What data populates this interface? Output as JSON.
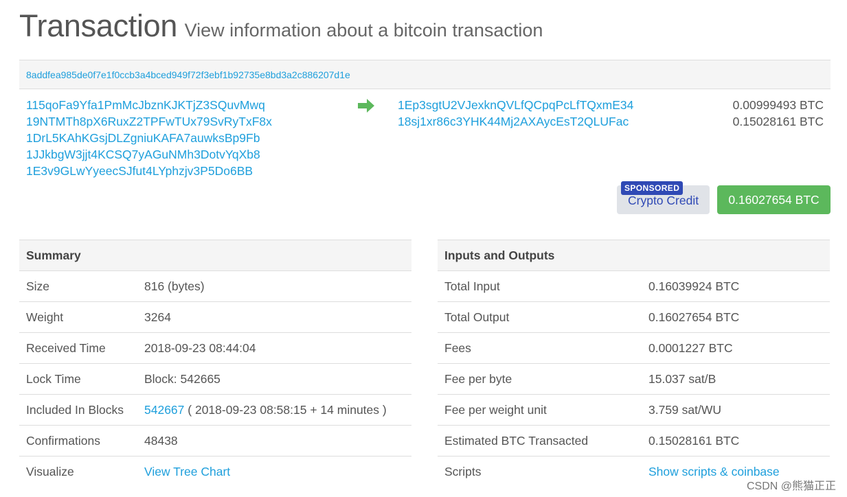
{
  "header": {
    "title": "Transaction",
    "subtitle": "View information about a bitcoin transaction"
  },
  "tx": {
    "hash": "8addfea985de0f7e1f0ccb3a4bced949f72f3ebf1b92735e8bd3a2c886207d1e",
    "inputs": [
      "115qoFa9Yfa1PmMcJbznKJKTjZ3SQuvMwq",
      "19NTMTh8pX6RuxZ2TPFwTUx79SvRyTxF8x",
      "1DrL5KAhKGsjDLZgniuKAFA7auwksBp9Fb",
      "1JJkbgW3jjt4KCSQ7yAGuNMh3DotvYqXb8",
      "1E3v9GLwYyeecSJfut4LYphzjv3P5Do6BB"
    ],
    "arrow_icon": "right-arrow-icon",
    "arrow_color": "#5cb85c",
    "outputs": [
      {
        "address": "1Ep3sgtU2VJexknQVLfQCpqPcLfTQxmE34",
        "amount": "0.00999493 BTC"
      },
      {
        "address": "18sj1xr86c3YHK44Mj2AXAycEsT2QLUFac",
        "amount": "0.15028161 BTC"
      }
    ],
    "sponsored_badge": "SPONSORED",
    "sponsored_label": "Crypto Credit",
    "total_button": "0.16027654 BTC"
  },
  "summary": {
    "heading": "Summary",
    "rows": [
      {
        "label": "Size",
        "value": "816 (bytes)"
      },
      {
        "label": "Weight",
        "value": "3264"
      },
      {
        "label": "Received Time",
        "value": "2018-09-23 08:44:04"
      },
      {
        "label": "Lock Time",
        "value": "Block: 542665"
      },
      {
        "label": "Included In Blocks",
        "link": "542667",
        "value": "( 2018-09-23 08:58:15 + 14 minutes )"
      },
      {
        "label": "Confirmations",
        "value": "48438"
      },
      {
        "label": "Visualize",
        "link": "View Tree Chart"
      }
    ]
  },
  "io": {
    "heading": "Inputs and Outputs",
    "rows": [
      {
        "label": "Total Input",
        "value": "0.16039924 BTC"
      },
      {
        "label": "Total Output",
        "value": "0.16027654 BTC"
      },
      {
        "label": "Fees",
        "value": "0.0001227 BTC"
      },
      {
        "label": "Fee per byte",
        "value": "15.037 sat/B"
      },
      {
        "label": "Fee per weight unit",
        "value": "3.759 sat/WU"
      },
      {
        "label": "Estimated BTC Transacted",
        "value": "0.15028161 BTC"
      },
      {
        "label": "Scripts",
        "link": "Show scripts & coinbase"
      }
    ]
  },
  "watermark": "CSDN @熊猫正正",
  "colors": {
    "link": "#1e9fdc",
    "success": "#5cb85c",
    "sponsor": "#2f49b5"
  }
}
